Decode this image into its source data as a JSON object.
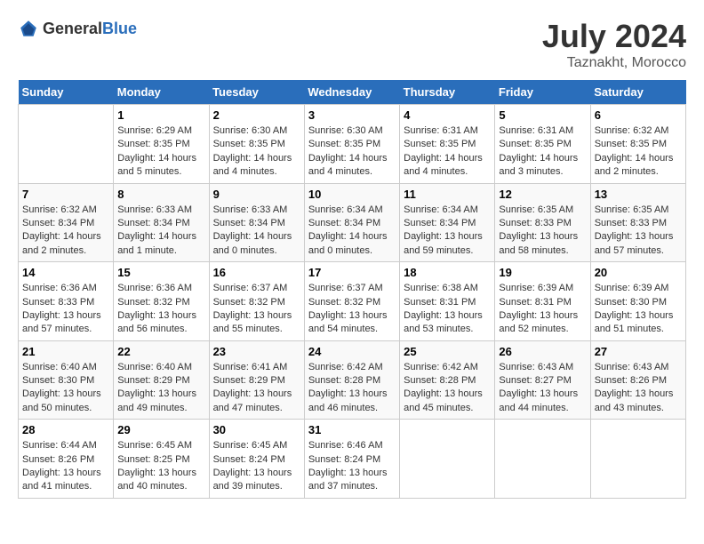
{
  "header": {
    "logo_general": "General",
    "logo_blue": "Blue",
    "month_year": "July 2024",
    "location": "Taznakht, Morocco"
  },
  "days_of_week": [
    "Sunday",
    "Monday",
    "Tuesday",
    "Wednesday",
    "Thursday",
    "Friday",
    "Saturday"
  ],
  "weeks": [
    [
      {
        "day": "",
        "sunrise": "",
        "sunset": "",
        "daylight": ""
      },
      {
        "day": "1",
        "sunrise": "Sunrise: 6:29 AM",
        "sunset": "Sunset: 8:35 PM",
        "daylight": "Daylight: 14 hours and 5 minutes."
      },
      {
        "day": "2",
        "sunrise": "Sunrise: 6:30 AM",
        "sunset": "Sunset: 8:35 PM",
        "daylight": "Daylight: 14 hours and 4 minutes."
      },
      {
        "day": "3",
        "sunrise": "Sunrise: 6:30 AM",
        "sunset": "Sunset: 8:35 PM",
        "daylight": "Daylight: 14 hours and 4 minutes."
      },
      {
        "day": "4",
        "sunrise": "Sunrise: 6:31 AM",
        "sunset": "Sunset: 8:35 PM",
        "daylight": "Daylight: 14 hours and 4 minutes."
      },
      {
        "day": "5",
        "sunrise": "Sunrise: 6:31 AM",
        "sunset": "Sunset: 8:35 PM",
        "daylight": "Daylight: 14 hours and 3 minutes."
      },
      {
        "day": "6",
        "sunrise": "Sunrise: 6:32 AM",
        "sunset": "Sunset: 8:35 PM",
        "daylight": "Daylight: 14 hours and 2 minutes."
      }
    ],
    [
      {
        "day": "7",
        "sunrise": "Sunrise: 6:32 AM",
        "sunset": "Sunset: 8:34 PM",
        "daylight": "Daylight: 14 hours and 2 minutes."
      },
      {
        "day": "8",
        "sunrise": "Sunrise: 6:33 AM",
        "sunset": "Sunset: 8:34 PM",
        "daylight": "Daylight: 14 hours and 1 minute."
      },
      {
        "day": "9",
        "sunrise": "Sunrise: 6:33 AM",
        "sunset": "Sunset: 8:34 PM",
        "daylight": "Daylight: 14 hours and 0 minutes."
      },
      {
        "day": "10",
        "sunrise": "Sunrise: 6:34 AM",
        "sunset": "Sunset: 8:34 PM",
        "daylight": "Daylight: 14 hours and 0 minutes."
      },
      {
        "day": "11",
        "sunrise": "Sunrise: 6:34 AM",
        "sunset": "Sunset: 8:34 PM",
        "daylight": "Daylight: 13 hours and 59 minutes."
      },
      {
        "day": "12",
        "sunrise": "Sunrise: 6:35 AM",
        "sunset": "Sunset: 8:33 PM",
        "daylight": "Daylight: 13 hours and 58 minutes."
      },
      {
        "day": "13",
        "sunrise": "Sunrise: 6:35 AM",
        "sunset": "Sunset: 8:33 PM",
        "daylight": "Daylight: 13 hours and 57 minutes."
      }
    ],
    [
      {
        "day": "14",
        "sunrise": "Sunrise: 6:36 AM",
        "sunset": "Sunset: 8:33 PM",
        "daylight": "Daylight: 13 hours and 57 minutes."
      },
      {
        "day": "15",
        "sunrise": "Sunrise: 6:36 AM",
        "sunset": "Sunset: 8:32 PM",
        "daylight": "Daylight: 13 hours and 56 minutes."
      },
      {
        "day": "16",
        "sunrise": "Sunrise: 6:37 AM",
        "sunset": "Sunset: 8:32 PM",
        "daylight": "Daylight: 13 hours and 55 minutes."
      },
      {
        "day": "17",
        "sunrise": "Sunrise: 6:37 AM",
        "sunset": "Sunset: 8:32 PM",
        "daylight": "Daylight: 13 hours and 54 minutes."
      },
      {
        "day": "18",
        "sunrise": "Sunrise: 6:38 AM",
        "sunset": "Sunset: 8:31 PM",
        "daylight": "Daylight: 13 hours and 53 minutes."
      },
      {
        "day": "19",
        "sunrise": "Sunrise: 6:39 AM",
        "sunset": "Sunset: 8:31 PM",
        "daylight": "Daylight: 13 hours and 52 minutes."
      },
      {
        "day": "20",
        "sunrise": "Sunrise: 6:39 AM",
        "sunset": "Sunset: 8:30 PM",
        "daylight": "Daylight: 13 hours and 51 minutes."
      }
    ],
    [
      {
        "day": "21",
        "sunrise": "Sunrise: 6:40 AM",
        "sunset": "Sunset: 8:30 PM",
        "daylight": "Daylight: 13 hours and 50 minutes."
      },
      {
        "day": "22",
        "sunrise": "Sunrise: 6:40 AM",
        "sunset": "Sunset: 8:29 PM",
        "daylight": "Daylight: 13 hours and 49 minutes."
      },
      {
        "day": "23",
        "sunrise": "Sunrise: 6:41 AM",
        "sunset": "Sunset: 8:29 PM",
        "daylight": "Daylight: 13 hours and 47 minutes."
      },
      {
        "day": "24",
        "sunrise": "Sunrise: 6:42 AM",
        "sunset": "Sunset: 8:28 PM",
        "daylight": "Daylight: 13 hours and 46 minutes."
      },
      {
        "day": "25",
        "sunrise": "Sunrise: 6:42 AM",
        "sunset": "Sunset: 8:28 PM",
        "daylight": "Daylight: 13 hours and 45 minutes."
      },
      {
        "day": "26",
        "sunrise": "Sunrise: 6:43 AM",
        "sunset": "Sunset: 8:27 PM",
        "daylight": "Daylight: 13 hours and 44 minutes."
      },
      {
        "day": "27",
        "sunrise": "Sunrise: 6:43 AM",
        "sunset": "Sunset: 8:26 PM",
        "daylight": "Daylight: 13 hours and 43 minutes."
      }
    ],
    [
      {
        "day": "28",
        "sunrise": "Sunrise: 6:44 AM",
        "sunset": "Sunset: 8:26 PM",
        "daylight": "Daylight: 13 hours and 41 minutes."
      },
      {
        "day": "29",
        "sunrise": "Sunrise: 6:45 AM",
        "sunset": "Sunset: 8:25 PM",
        "daylight": "Daylight: 13 hours and 40 minutes."
      },
      {
        "day": "30",
        "sunrise": "Sunrise: 6:45 AM",
        "sunset": "Sunset: 8:24 PM",
        "daylight": "Daylight: 13 hours and 39 minutes."
      },
      {
        "day": "31",
        "sunrise": "Sunrise: 6:46 AM",
        "sunset": "Sunset: 8:24 PM",
        "daylight": "Daylight: 13 hours and 37 minutes."
      },
      {
        "day": "",
        "sunrise": "",
        "sunset": "",
        "daylight": ""
      },
      {
        "day": "",
        "sunrise": "",
        "sunset": "",
        "daylight": ""
      },
      {
        "day": "",
        "sunrise": "",
        "sunset": "",
        "daylight": ""
      }
    ]
  ]
}
